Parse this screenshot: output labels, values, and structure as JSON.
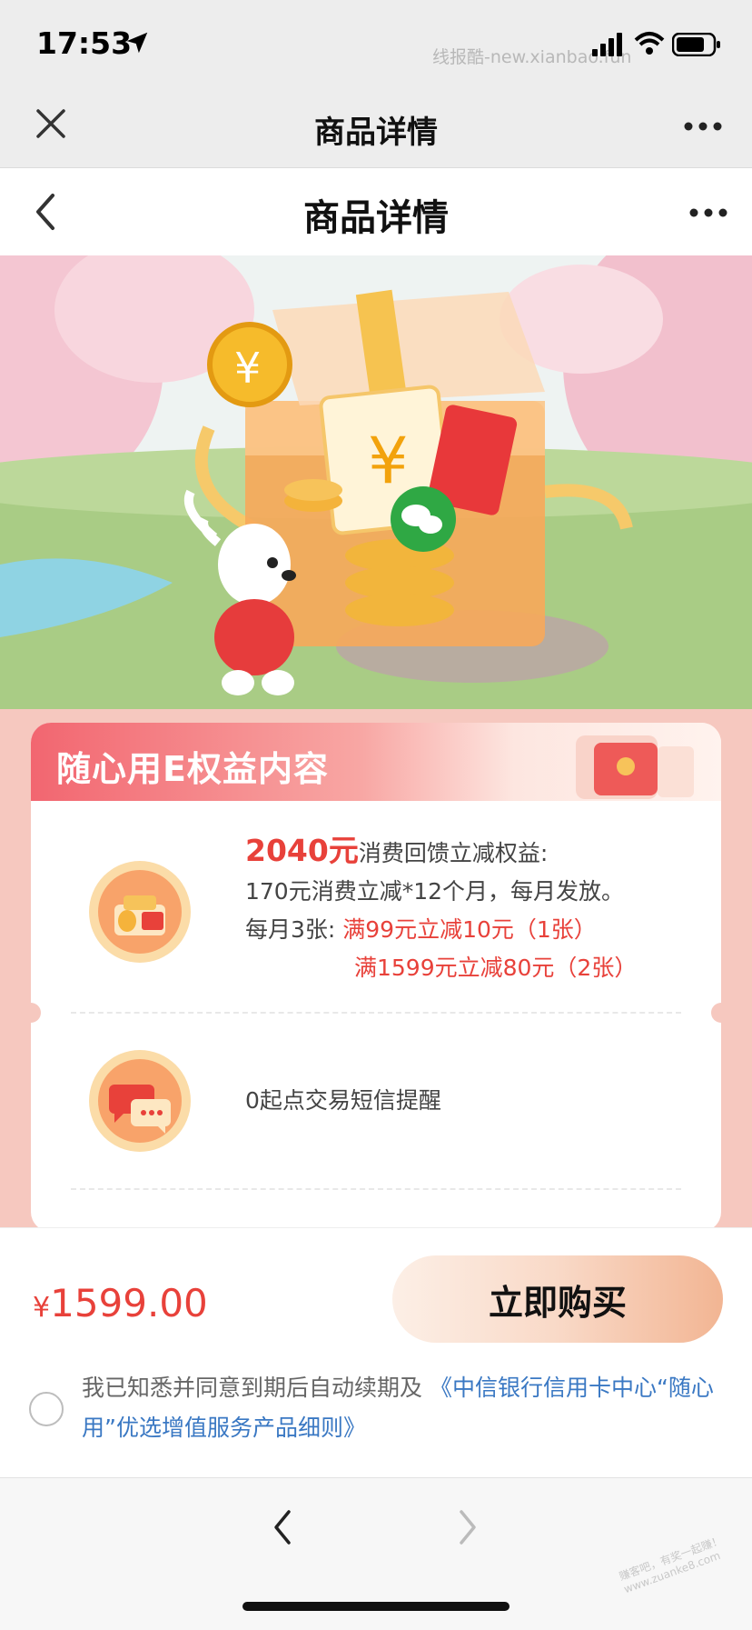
{
  "status_bar": {
    "time": "17:53",
    "watermark": "线报酷-new.xianbao.fun"
  },
  "browser_nav": {
    "title": "商品详情",
    "close_icon": "close-icon",
    "more_icon": "more-icon"
  },
  "page_nav": {
    "title": "商品详情",
    "back_icon": "chevron-left-icon",
    "more_icon": "more-icon"
  },
  "banner": {
    "description_icons": [
      "gift-box",
      "coin-medal",
      "mascot",
      "red-envelope",
      "wechat-icon"
    ]
  },
  "benefits": {
    "title": "随心用E权益内容",
    "items": [
      {
        "icon": "gift-coupon-icon",
        "amount": "2040元",
        "headline_suffix": "消费回馈立减权益:",
        "line2": "170元消费立减*12个月，每月发放。",
        "line3_prefix": "每月3张: ",
        "line3_red": "满99元立减10元（1张）",
        "line4_red": "满1599元立减80元（2张）"
      },
      {
        "icon": "sms-chat-icon",
        "text": "0起点交易短信提醒"
      }
    ]
  },
  "purchase": {
    "currency": "¥",
    "price": "1599.00",
    "buy_label": "立即购买",
    "agreement_text": "我已知悉并同意到期后自动续期及",
    "agreement_link": "《中信银行信用卡中心“随心用”优选增值服务产品细则》",
    "agreement_checked": false
  },
  "toolbar": {
    "back_icon": "chevron-left-icon",
    "forward_icon": "chevron-right-icon"
  },
  "corner_watermark": "赚客吧，有奖一起赚！www.zuanke8.com",
  "colors": {
    "accent_red": "#e8413a",
    "link_blue": "#3a78c3",
    "header_bg": "#ededed",
    "card_pink": "#f6c8bf"
  }
}
